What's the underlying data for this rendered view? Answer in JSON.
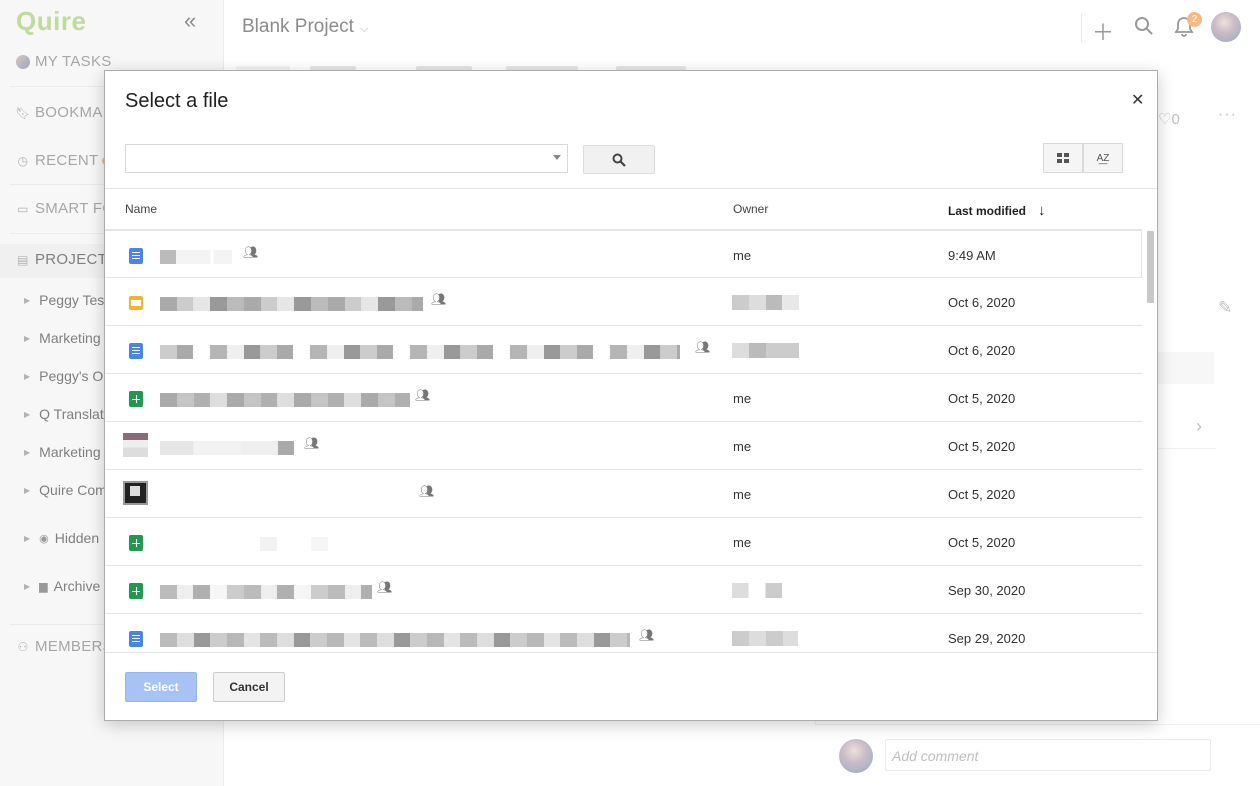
{
  "sidebar": {
    "logo": "Quire",
    "nav": {
      "my_tasks": "MY TASKS",
      "bookmarks": "BOOKMA",
      "recent": "RECENT",
      "smart_folders": "SMART FO",
      "projects": "PROJECTS",
      "members": "MEMBERS"
    },
    "projects": [
      {
        "label": "Peggy Testi"
      },
      {
        "label": "Marketing"
      },
      {
        "label": "Peggy's Or"
      },
      {
        "label": "Q Translati"
      },
      {
        "label": "Marketing"
      },
      {
        "label": "Quire Com"
      },
      {
        "label": "Hidden"
      },
      {
        "label": "Archive"
      }
    ]
  },
  "header": {
    "project_title": "Blank Project",
    "notification_count": "2"
  },
  "right_panel": {
    "likes": "0",
    "comment_placeholder": "Add comment"
  },
  "dialog": {
    "title": "Select a file",
    "columns": {
      "name": "Name",
      "owner": "Owner",
      "modified": "Last modified"
    },
    "files": [
      {
        "type": "doc",
        "owner": "me",
        "modified": "9:49 AM"
      },
      {
        "type": "slides",
        "owner": "",
        "modified": "Oct 6, 2020"
      },
      {
        "type": "doc",
        "owner": "",
        "modified": "Oct 6, 2020"
      },
      {
        "type": "sheet",
        "owner": "me",
        "modified": "Oct 5, 2020"
      },
      {
        "type": "image",
        "owner": "me",
        "modified": "Oct 5, 2020"
      },
      {
        "type": "image",
        "owner": "me",
        "modified": "Oct 5, 2020"
      },
      {
        "type": "sheet",
        "owner": "me",
        "modified": "Oct 5, 2020"
      },
      {
        "type": "sheet",
        "owner": "",
        "modified": "Sep 30, 2020"
      },
      {
        "type": "doc",
        "owner": "",
        "modified": "Sep 29, 2020"
      }
    ],
    "select_label": "Select",
    "cancel_label": "Cancel"
  }
}
